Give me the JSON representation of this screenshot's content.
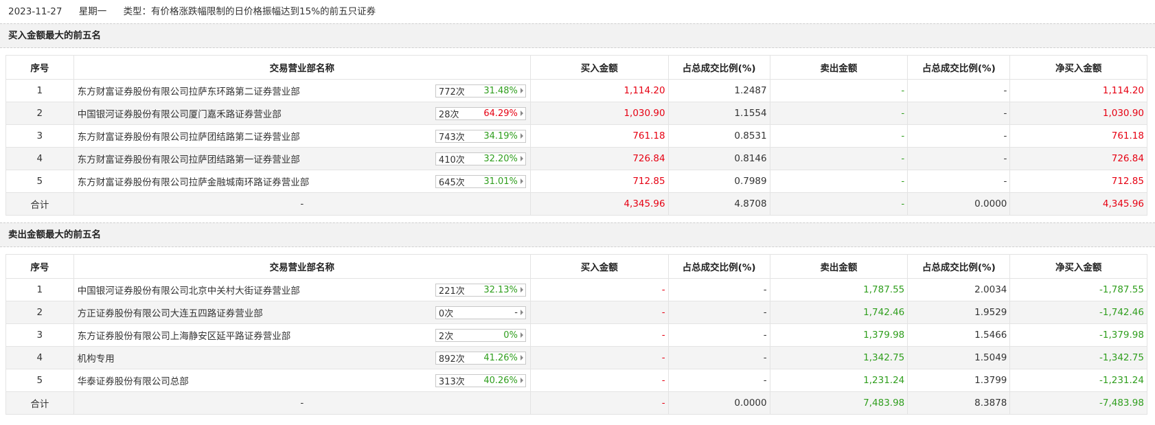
{
  "header": {
    "date": "2023-11-27",
    "weekday": "星期一",
    "type": "类型：有价格涨跌幅限制的日价格振幅达到15%的前五只证券"
  },
  "columns": [
    "序号",
    "交易营业部名称",
    "买入金额",
    "占总成交比例(%)",
    "卖出金额",
    "占总成交比例(%)",
    "净买入金额"
  ],
  "buy_section": {
    "title": "买入金额最大的前五名",
    "rows": [
      {
        "idx": "1",
        "name": "东方财富证券股份有限公司拉萨东环路第二证券营业部",
        "count": "772次",
        "pct": "31.48%",
        "pct_color": "green",
        "buy": "1,114.20",
        "buy_ratio": "1.2487",
        "sell": "-",
        "sell_ratio": "-",
        "net": "1,114.20"
      },
      {
        "idx": "2",
        "name": "中国银河证券股份有限公司厦门嘉禾路证券营业部",
        "count": "28次",
        "pct": "64.29%",
        "pct_color": "red",
        "buy": "1,030.90",
        "buy_ratio": "1.1554",
        "sell": "-",
        "sell_ratio": "-",
        "net": "1,030.90"
      },
      {
        "idx": "3",
        "name": "东方财富证券股份有限公司拉萨团结路第二证券营业部",
        "count": "743次",
        "pct": "34.19%",
        "pct_color": "green",
        "buy": "761.18",
        "buy_ratio": "0.8531",
        "sell": "-",
        "sell_ratio": "-",
        "net": "761.18"
      },
      {
        "idx": "4",
        "name": "东方财富证券股份有限公司拉萨团结路第一证券营业部",
        "count": "410次",
        "pct": "32.20%",
        "pct_color": "green",
        "buy": "726.84",
        "buy_ratio": "0.8146",
        "sell": "-",
        "sell_ratio": "-",
        "net": "726.84"
      },
      {
        "idx": "5",
        "name": "东方财富证券股份有限公司拉萨金融城南环路证券营业部",
        "count": "645次",
        "pct": "31.01%",
        "pct_color": "green",
        "buy": "712.85",
        "buy_ratio": "0.7989",
        "sell": "-",
        "sell_ratio": "-",
        "net": "712.85"
      }
    ],
    "total": {
      "label": "合计",
      "name": "-",
      "buy": "4,345.96",
      "buy_ratio": "4.8708",
      "sell": "-",
      "sell_ratio": "0.0000",
      "net": "4,345.96"
    }
  },
  "sell_section": {
    "title": "卖出金额最大的前五名",
    "rows": [
      {
        "idx": "1",
        "name": "中国银河证券股份有限公司北京中关村大街证券营业部",
        "count": "221次",
        "pct": "32.13%",
        "pct_color": "green",
        "buy": "-",
        "buy_ratio": "-",
        "sell": "1,787.55",
        "sell_ratio": "2.0034",
        "net": "-1,787.55"
      },
      {
        "idx": "2",
        "name": "方正证券股份有限公司大连五四路证券营业部",
        "count": "0次",
        "pct": "-",
        "pct_color": "gray",
        "buy": "-",
        "buy_ratio": "-",
        "sell": "1,742.46",
        "sell_ratio": "1.9529",
        "net": "-1,742.46"
      },
      {
        "idx": "3",
        "name": "东方证券股份有限公司上海静安区延平路证券营业部",
        "count": "2次",
        "pct": "0%",
        "pct_color": "green",
        "buy": "-",
        "buy_ratio": "-",
        "sell": "1,379.98",
        "sell_ratio": "1.5466",
        "net": "-1,379.98"
      },
      {
        "idx": "4",
        "name": "机构专用",
        "count": "892次",
        "pct": "41.26%",
        "pct_color": "green",
        "buy": "-",
        "buy_ratio": "-",
        "sell": "1,342.75",
        "sell_ratio": "1.5049",
        "net": "-1,342.75"
      },
      {
        "idx": "5",
        "name": "华泰证券股份有限公司总部",
        "count": "313次",
        "pct": "40.26%",
        "pct_color": "green",
        "buy": "-",
        "buy_ratio": "-",
        "sell": "1,231.24",
        "sell_ratio": "1.3799",
        "net": "-1,231.24"
      }
    ],
    "total": {
      "label": "合计",
      "name": "-",
      "buy": "-",
      "buy_ratio": "0.0000",
      "sell": "7,483.98",
      "sell_ratio": "8.3878",
      "net": "-7,483.98"
    }
  },
  "colors": {
    "red": "#e60012",
    "green": "#2f9e1d",
    "gray": "#333333"
  }
}
